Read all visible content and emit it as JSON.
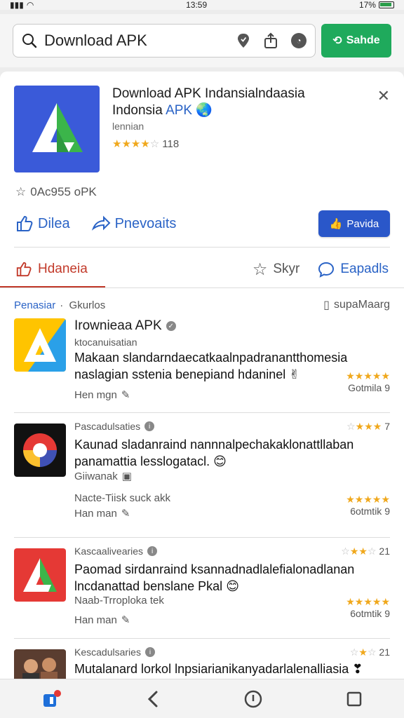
{
  "status": {
    "time": "13:59",
    "battery": "17%"
  },
  "search": {
    "value": "Download APK",
    "button_label": "Sahde"
  },
  "app": {
    "title_main": "Download APK Indansialndaasia",
    "title_line2": "Indonsia",
    "title_apk": "APK",
    "subtitle": "lennian",
    "rating_count": "118",
    "meta": "0Ac955 οPK"
  },
  "actions": {
    "like": "Dilea",
    "share": "Pnevoaits",
    "primary": "Pavida"
  },
  "tabs": {
    "active": "Hdaneia",
    "star": "Skyr",
    "chat": "Eapadls"
  },
  "filter": {
    "primary": "Penasiar",
    "secondary": "Gkurlos",
    "right": "supaMaarg"
  },
  "items": [
    {
      "title": "Irownieaa APK",
      "small": "ktocanuisatian",
      "desc1": "Makaan slandarndaecatkaalnpadranantthomesia",
      "desc2": "naslagian sstenia benepiand hdaninel",
      "meta": "Hen mgn",
      "right_label": "Gotmila  9"
    },
    {
      "title": "Pascadulsaties",
      "desc1": "Kaunad sladanraind nannnalpechakaklonattllaban",
      "desc2": "panamattia lesslogatacl.",
      "sub": "Giiwanak",
      "meta1": "Nacte-Tiisk suck akk",
      "meta2": "Han man",
      "top_right": "7",
      "right_label": "6otmtik  9"
    },
    {
      "title": "Kascaalivearies",
      "desc1": "Paomad sirdanraind ksannadnadlalefialonadlanan",
      "desc2": "lncdanattad benslane Pkal",
      "meta1": "Naab-Trroploka tek",
      "meta2": "Han man",
      "top_right": "21",
      "right_label": "6otmtik  9"
    },
    {
      "title": "Kescadulsaries",
      "desc1": "Mutalanard lorkol lnpsiarianikanyadarlalenalliasia",
      "top_right": "21"
    }
  ],
  "colors": {
    "accent_blue": "#2a63c6",
    "accent_green": "#1faa5c",
    "accent_red": "#c23a2a",
    "star": "#f0a81c"
  }
}
